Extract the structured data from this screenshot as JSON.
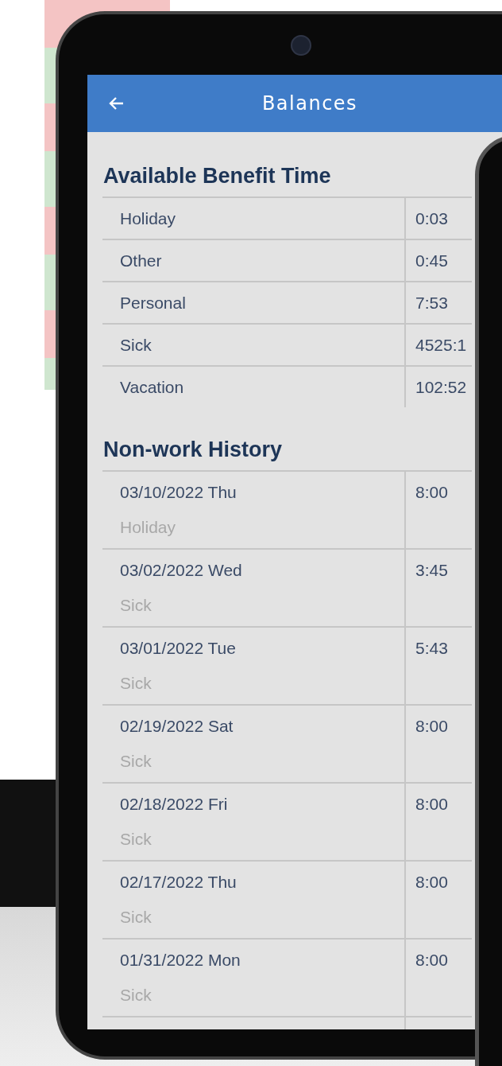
{
  "header": {
    "title": "Balances"
  },
  "benefit_time": {
    "title": "Available Benefit Time",
    "rows": [
      {
        "type": "Holiday",
        "balance": "0:03"
      },
      {
        "type": "Other",
        "balance": "0:45"
      },
      {
        "type": "Personal",
        "balance": "7:53"
      },
      {
        "type": "Sick",
        "balance": "4525:1"
      },
      {
        "type": "Vacation",
        "balance": "102:52"
      }
    ]
  },
  "history": {
    "title": "Non-work History",
    "rows": [
      {
        "date": "03/10/2022 Thu",
        "type": "Holiday",
        "hours": "8:00"
      },
      {
        "date": "03/02/2022 Wed",
        "type": "Sick",
        "hours": "3:45"
      },
      {
        "date": "03/01/2022 Tue",
        "type": "Sick",
        "hours": "5:43"
      },
      {
        "date": "02/19/2022 Sat",
        "type": "Sick",
        "hours": "8:00"
      },
      {
        "date": "02/18/2022 Fri",
        "type": "Sick",
        "hours": "8:00"
      },
      {
        "date": "02/17/2022 Thu",
        "type": "Sick",
        "hours": "8:00"
      },
      {
        "date": "01/31/2022 Mon",
        "type": "Sick",
        "hours": "8:00"
      }
    ]
  }
}
